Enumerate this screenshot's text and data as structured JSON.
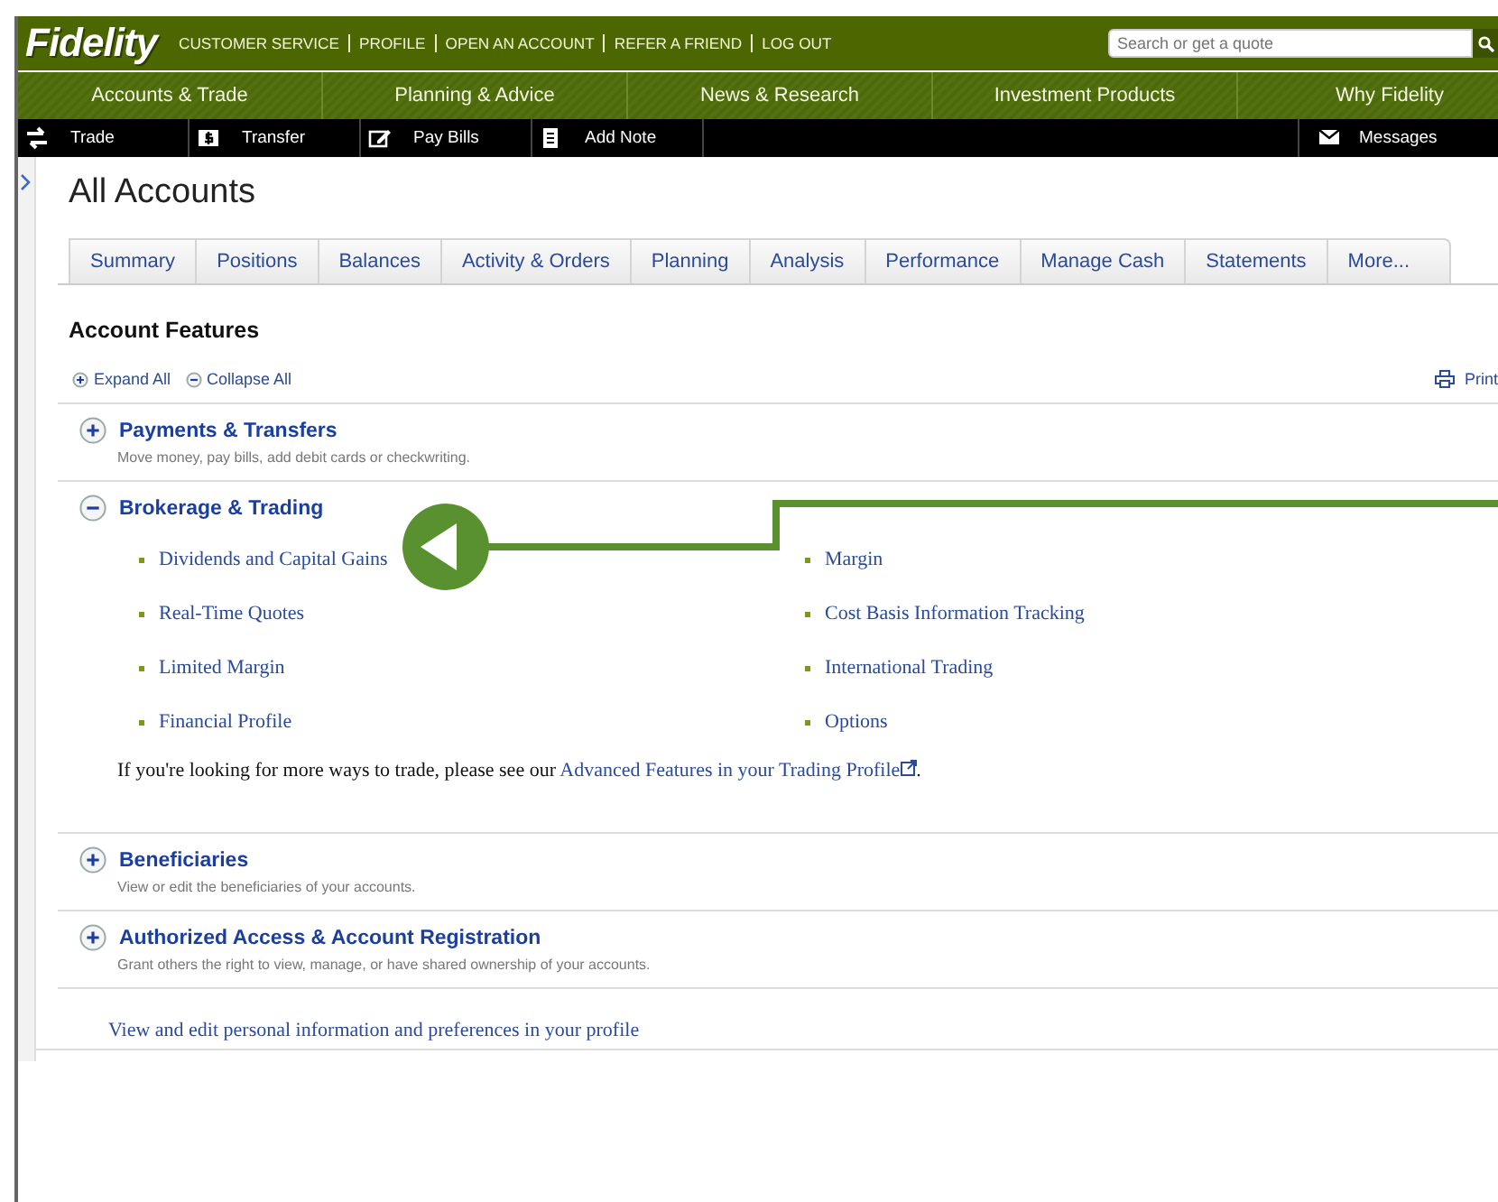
{
  "header": {
    "logo": "Fidelity",
    "links": [
      "CUSTOMER SERVICE",
      "PROFILE",
      "OPEN AN ACCOUNT",
      "REFER A FRIEND",
      "LOG OUT"
    ],
    "search": {
      "placeholder": "Search or get a quote"
    }
  },
  "main_nav": [
    "Accounts & Trade",
    "Planning & Advice",
    "News & Research",
    "Investment Products",
    "Why Fidelity"
  ],
  "action_bar": {
    "left": [
      {
        "label": "Trade",
        "kind": "trade"
      },
      {
        "label": "Transfer",
        "kind": "transfer"
      },
      {
        "label": "Pay Bills",
        "kind": "bills"
      },
      {
        "label": "Add Note",
        "kind": "note"
      }
    ],
    "right": [
      {
        "label": "Messages",
        "kind": "messages"
      }
    ]
  },
  "page_title": "All Accounts",
  "tabs": [
    {
      "label": "Summary",
      "selected": false
    },
    {
      "label": "Positions",
      "selected": false
    },
    {
      "label": "Balances",
      "selected": false
    },
    {
      "label": "Activity & Orders",
      "selected": false
    },
    {
      "label": "Planning",
      "selected": false
    },
    {
      "label": "Analysis",
      "selected": false
    },
    {
      "label": "Performance",
      "selected": false
    },
    {
      "label": "Manage Cash",
      "selected": false
    },
    {
      "label": "Statements",
      "selected": false
    },
    {
      "label": "More...",
      "selected": false
    }
  ],
  "features": {
    "title": "Account Features",
    "expand_all": "Expand All",
    "collapse_all": "Collapse All",
    "print": "Print",
    "sections": [
      {
        "title": "Payments & Transfers",
        "expanded": false,
        "description": "Move money, pay bills, add debit cards or checkwriting."
      },
      {
        "title": "Brokerage & Trading",
        "expanded": true,
        "columns": [
          [
            "Dividends and Capital Gains",
            "Real-Time Quotes",
            "Limited Margin",
            "Financial Profile"
          ],
          [
            "Margin",
            "Cost Basis Information Tracking",
            "International Trading",
            "Options"
          ]
        ],
        "note": "If you're looking for more ways to trade, please see our ",
        "note_link": "Advanced Features in your Trading Profile",
        "note_end": "."
      },
      {
        "title": "Beneficiaries",
        "expanded": false,
        "description": "View or edit the beneficiaries of your accounts."
      },
      {
        "title": "Authorized Access & Account Registration",
        "expanded": false,
        "description": "Grant others the right to view, manage, or have shared ownership of your accounts."
      }
    ]
  },
  "profile_link": "View and edit personal information and preferences in your profile"
}
